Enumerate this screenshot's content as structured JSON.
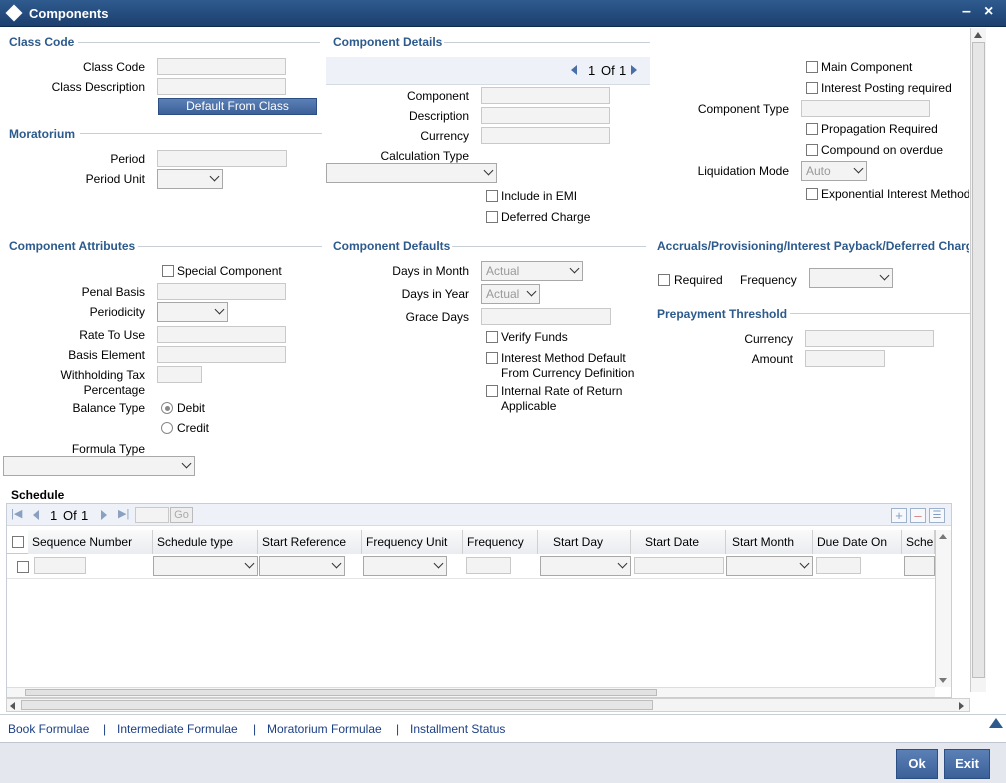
{
  "window": {
    "title": "Components"
  },
  "class_code": {
    "section": "Class Code",
    "class_code_label": "Class Code",
    "class_desc_label": "Class Description",
    "default_button": "Default From Class"
  },
  "moratorium": {
    "section": "Moratorium",
    "period_label": "Period",
    "period_unit_label": "Period Unit"
  },
  "component_details": {
    "section": "Component Details",
    "nav_current": "1",
    "nav_of": "Of",
    "nav_total": "1",
    "component_label": "Component",
    "description_label": "Description",
    "currency_label": "Currency",
    "calc_type_label": "Calculation Type",
    "include_emi": "Include in EMI",
    "deferred_charge": "Deferred Charge"
  },
  "right_panel": {
    "main_component": "Main Component",
    "interest_posting": "Interest Posting required",
    "component_type_label": "Component Type",
    "propagation": "Propagation Required",
    "compound_overdue": "Compound on overdue",
    "liquidation_label": "Liquidation Mode",
    "liquidation_value": "Auto",
    "exponential": "Exponential Interest Method"
  },
  "attributes": {
    "section": "Component Attributes",
    "special": "Special Component",
    "penal_basis": "Penal Basis",
    "periodicity": "Periodicity",
    "rate_to_use": "Rate To Use",
    "basis_element": "Basis Element",
    "withholding_1": "Withholding Tax",
    "withholding_2": "Percentage",
    "balance_type": "Balance Type",
    "debit": "Debit",
    "credit": "Credit",
    "formula_type": "Formula Type"
  },
  "defaults": {
    "section": "Component Defaults",
    "days_month": "Days in Month",
    "days_month_val": "Actual",
    "days_year": "Days in Year",
    "days_year_val": "Actual",
    "grace_days": "Grace Days",
    "verify_funds": "Verify Funds",
    "int_method_1": "Interest Method Default",
    "int_method_2": "From Currency Definition",
    "irr_1": "Internal Rate of Return",
    "irr_2": "Applicable"
  },
  "accruals": {
    "section": "Accruals/Provisioning/Interest Payback/Deferred Charg",
    "required": "Required",
    "frequency": "Frequency"
  },
  "prepayment": {
    "section": "Prepayment Threshold",
    "currency": "Currency",
    "amount": "Amount"
  },
  "schedule": {
    "section": "Schedule",
    "page_current": "1",
    "page_of": "Of",
    "page_total": "1",
    "go": "Go",
    "columns": [
      "Sequence Number",
      "Schedule type",
      "Start Reference",
      "Frequency Unit",
      "Frequency",
      "Start Day",
      "Start Date",
      "Start Month",
      "Due Date On",
      "Sche"
    ]
  },
  "footer_links": [
    "Book Formulae",
    "|",
    "Intermediate Formulae",
    "|",
    "Moratorium Formulae",
    "|",
    "Installment Status"
  ],
  "buttons": {
    "ok": "Ok",
    "exit": "Exit"
  },
  "colors": {
    "title_bar": "#1c3f6e",
    "section": "#2c5a8c",
    "link": "#1c3f84"
  }
}
